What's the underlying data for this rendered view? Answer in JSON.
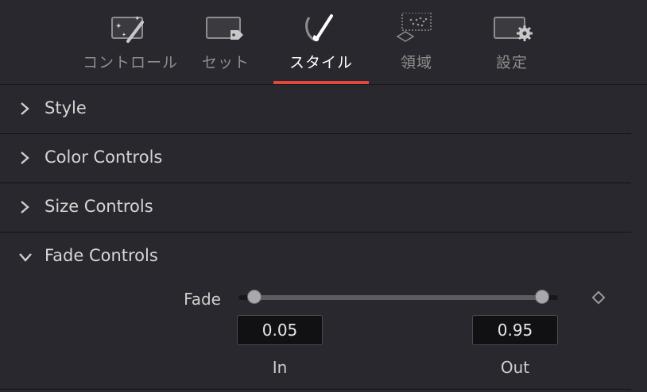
{
  "tabs": [
    {
      "label": "コントロール",
      "icon": "magic-wand-icon",
      "active": false
    },
    {
      "label": "セット",
      "icon": "tag-icon",
      "active": false
    },
    {
      "label": "スタイル",
      "icon": "brush-icon",
      "active": true
    },
    {
      "label": "領域",
      "icon": "region-icon",
      "active": false
    },
    {
      "label": "設定",
      "icon": "gear-icon",
      "active": false
    }
  ],
  "sections": [
    {
      "title": "Style",
      "expanded": false
    },
    {
      "title": "Color Controls",
      "expanded": false
    },
    {
      "title": "Size Controls",
      "expanded": false
    },
    {
      "title": "Fade Controls",
      "expanded": true
    }
  ],
  "fade": {
    "label": "Fade",
    "in_value": "0.05",
    "out_value": "0.95",
    "in_label": "In",
    "out_label": "Out",
    "range_start": 0.05,
    "range_end": 0.95
  },
  "colors": {
    "accent": "#e0483e",
    "panel_bg": "#28282e"
  }
}
